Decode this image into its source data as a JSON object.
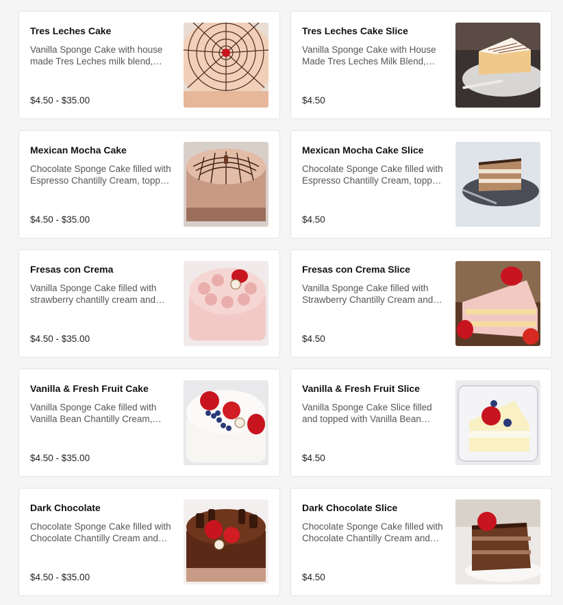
{
  "menu": {
    "items": [
      {
        "name": "Tres Leches Cake",
        "description": "Vanilla Sponge Cake with house made Tres Leches milk blend, topped with whipped cream.",
        "price": "$4.50 - $35.00",
        "image": "tres-leches-cake-image"
      },
      {
        "name": "Tres Leches Cake Slice",
        "description": "Vanilla Sponge Cake with House Made Tres Leches Milk Blend, topped with whipped cream.",
        "price": "$4.50",
        "image": "tres-leches-slice-image"
      },
      {
        "name": "Mexican Mocha Cake",
        "description": "Chocolate Sponge Cake filled with Espresso Chantilly Cream, topped with cinnamon.",
        "price": "$4.50 - $35.00",
        "image": "mexican-mocha-cake-image"
      },
      {
        "name": "Mexican Mocha Cake Slice",
        "description": "Chocolate Sponge Cake filled with Espresso Chantilly Cream, topped with cinnamon.",
        "price": "$4.50",
        "image": "mexican-mocha-slice-image"
      },
      {
        "name": "Fresas con Crema",
        "description": "Vanilla Sponge Cake filled with strawberry chantilly cream and fresh strawberries.",
        "price": "$4.50 - $35.00",
        "image": "fresas-con-crema-cake-image"
      },
      {
        "name": "Fresas con Crema Slice",
        "description": "Vanilla Sponge Cake filled with Strawberry Chantilly Cream and fresh strawberries.",
        "price": "$4.50",
        "image": "fresas-con-crema-slice-image"
      },
      {
        "name": "Vanilla & Fresh Fruit Cake",
        "description": "Vanilla Sponge Cake filled with Vanilla Bean Chantilly Cream, fresh fruit.",
        "price": "$4.50 - $35.00",
        "image": "vanilla-fruit-cake-image"
      },
      {
        "name": "Vanilla & Fresh Fruit Slice",
        "description": "Vanilla Sponge Cake Slice filled and topped with Vanilla Bean Chantilly Cream.",
        "price": "$4.50",
        "image": "vanilla-fruit-slice-image"
      },
      {
        "name": "Dark Chocolate",
        "description": "Chocolate Sponge Cake filled with Chocolate Chantilly Cream and ganache.",
        "price": "$4.50 - $35.00",
        "image": "dark-chocolate-cake-image"
      },
      {
        "name": "Dark Chocolate Slice",
        "description": "Chocolate Sponge Cake filled with Chocolate Chantilly Cream and ganache.",
        "price": "$4.50",
        "image": "dark-chocolate-slice-image"
      }
    ]
  }
}
